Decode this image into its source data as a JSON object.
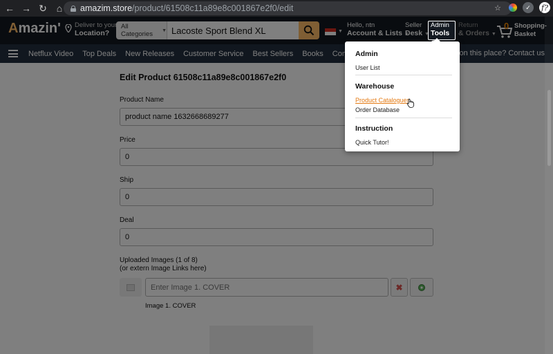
{
  "browser": {
    "url_host": "amazim.store",
    "url_path": "/product/61508c11a89e8c001867e2f0/edit",
    "ext_letter": "f?"
  },
  "header": {
    "logo_text": "mazin'",
    "logo_letter": "A",
    "deliver_line1": "Deliver to your",
    "deliver_line2": "Location?",
    "search_category": "All Categories",
    "search_value": "Lacoste Sport Blend XL",
    "account_line1": "Hello, ntn",
    "account_line2": "Account & Lists",
    "seller_line1": "Seller",
    "seller_line2": "Desk",
    "admin_line1": "Admin",
    "admin_line2": "Tools",
    "returns_line1": "Return",
    "returns_line2": "& Orders",
    "cart_count": "0",
    "cart_line1": "Shopping-",
    "cart_line2": "Basket"
  },
  "subnav": {
    "items": [
      "Netflux Video",
      "Top Deals",
      "New Releases",
      "Customer Service",
      "Best Sellers",
      "Books",
      "Computers"
    ],
    "right_text": "ere on this place? Contact us"
  },
  "form": {
    "title": "Edit Product 61508c11a89e8c001867e2f0",
    "product_name_label": "Product Name",
    "product_name_value": "product name 1632668689277",
    "price_label": "Price",
    "price_value": "0",
    "ship_label": "Ship",
    "ship_value": "0",
    "deal_label": "Deal",
    "deal_value": "0",
    "images_label_line1": "Uploaded Images (1 of 8)",
    "images_label_line2": "(or extern Image Links here)",
    "image_input_placeholder": "Enter Image 1. COVER",
    "image_caption": "Image 1. COVER",
    "delete_symbol": "✖"
  },
  "dropdown": {
    "section_admin": "Admin",
    "user_list": "User List",
    "section_warehouse": "Warehouse",
    "product_catalogues": "Product Catalogues",
    "order_database": "Order Database",
    "section_instruction": "Instruction",
    "quick_tutor": "Quick Tutor!"
  },
  "colors": {
    "header_bg": "#131921",
    "subnav_bg": "#232f3e",
    "accent": "#febd69",
    "link_active": "#e47911"
  }
}
